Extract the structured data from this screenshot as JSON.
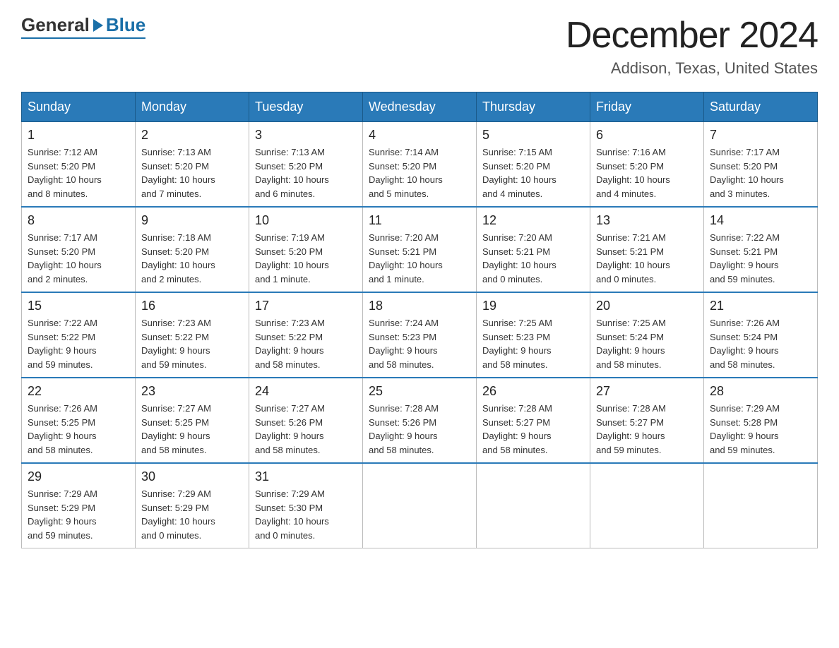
{
  "logo": {
    "general": "General",
    "blue": "Blue"
  },
  "title": "December 2024",
  "location": "Addison, Texas, United States",
  "days_of_week": [
    "Sunday",
    "Monday",
    "Tuesday",
    "Wednesday",
    "Thursday",
    "Friday",
    "Saturday"
  ],
  "weeks": [
    [
      {
        "day": "1",
        "sunrise": "7:12 AM",
        "sunset": "5:20 PM",
        "daylight": "10 hours and 8 minutes."
      },
      {
        "day": "2",
        "sunrise": "7:13 AM",
        "sunset": "5:20 PM",
        "daylight": "10 hours and 7 minutes."
      },
      {
        "day": "3",
        "sunrise": "7:13 AM",
        "sunset": "5:20 PM",
        "daylight": "10 hours and 6 minutes."
      },
      {
        "day": "4",
        "sunrise": "7:14 AM",
        "sunset": "5:20 PM",
        "daylight": "10 hours and 5 minutes."
      },
      {
        "day": "5",
        "sunrise": "7:15 AM",
        "sunset": "5:20 PM",
        "daylight": "10 hours and 4 minutes."
      },
      {
        "day": "6",
        "sunrise": "7:16 AM",
        "sunset": "5:20 PM",
        "daylight": "10 hours and 4 minutes."
      },
      {
        "day": "7",
        "sunrise": "7:17 AM",
        "sunset": "5:20 PM",
        "daylight": "10 hours and 3 minutes."
      }
    ],
    [
      {
        "day": "8",
        "sunrise": "7:17 AM",
        "sunset": "5:20 PM",
        "daylight": "10 hours and 2 minutes."
      },
      {
        "day": "9",
        "sunrise": "7:18 AM",
        "sunset": "5:20 PM",
        "daylight": "10 hours and 2 minutes."
      },
      {
        "day": "10",
        "sunrise": "7:19 AM",
        "sunset": "5:20 PM",
        "daylight": "10 hours and 1 minute."
      },
      {
        "day": "11",
        "sunrise": "7:20 AM",
        "sunset": "5:21 PM",
        "daylight": "10 hours and 1 minute."
      },
      {
        "day": "12",
        "sunrise": "7:20 AM",
        "sunset": "5:21 PM",
        "daylight": "10 hours and 0 minutes."
      },
      {
        "day": "13",
        "sunrise": "7:21 AM",
        "sunset": "5:21 PM",
        "daylight": "10 hours and 0 minutes."
      },
      {
        "day": "14",
        "sunrise": "7:22 AM",
        "sunset": "5:21 PM",
        "daylight": "9 hours and 59 minutes."
      }
    ],
    [
      {
        "day": "15",
        "sunrise": "7:22 AM",
        "sunset": "5:22 PM",
        "daylight": "9 hours and 59 minutes."
      },
      {
        "day": "16",
        "sunrise": "7:23 AM",
        "sunset": "5:22 PM",
        "daylight": "9 hours and 59 minutes."
      },
      {
        "day": "17",
        "sunrise": "7:23 AM",
        "sunset": "5:22 PM",
        "daylight": "9 hours and 58 minutes."
      },
      {
        "day": "18",
        "sunrise": "7:24 AM",
        "sunset": "5:23 PM",
        "daylight": "9 hours and 58 minutes."
      },
      {
        "day": "19",
        "sunrise": "7:25 AM",
        "sunset": "5:23 PM",
        "daylight": "9 hours and 58 minutes."
      },
      {
        "day": "20",
        "sunrise": "7:25 AM",
        "sunset": "5:24 PM",
        "daylight": "9 hours and 58 minutes."
      },
      {
        "day": "21",
        "sunrise": "7:26 AM",
        "sunset": "5:24 PM",
        "daylight": "9 hours and 58 minutes."
      }
    ],
    [
      {
        "day": "22",
        "sunrise": "7:26 AM",
        "sunset": "5:25 PM",
        "daylight": "9 hours and 58 minutes."
      },
      {
        "day": "23",
        "sunrise": "7:27 AM",
        "sunset": "5:25 PM",
        "daylight": "9 hours and 58 minutes."
      },
      {
        "day": "24",
        "sunrise": "7:27 AM",
        "sunset": "5:26 PM",
        "daylight": "9 hours and 58 minutes."
      },
      {
        "day": "25",
        "sunrise": "7:28 AM",
        "sunset": "5:26 PM",
        "daylight": "9 hours and 58 minutes."
      },
      {
        "day": "26",
        "sunrise": "7:28 AM",
        "sunset": "5:27 PM",
        "daylight": "9 hours and 58 minutes."
      },
      {
        "day": "27",
        "sunrise": "7:28 AM",
        "sunset": "5:27 PM",
        "daylight": "9 hours and 59 minutes."
      },
      {
        "day": "28",
        "sunrise": "7:29 AM",
        "sunset": "5:28 PM",
        "daylight": "9 hours and 59 minutes."
      }
    ],
    [
      {
        "day": "29",
        "sunrise": "7:29 AM",
        "sunset": "5:29 PM",
        "daylight": "9 hours and 59 minutes."
      },
      {
        "day": "30",
        "sunrise": "7:29 AM",
        "sunset": "5:29 PM",
        "daylight": "10 hours and 0 minutes."
      },
      {
        "day": "31",
        "sunrise": "7:29 AM",
        "sunset": "5:30 PM",
        "daylight": "10 hours and 0 minutes."
      },
      null,
      null,
      null,
      null
    ]
  ],
  "labels": {
    "sunrise": "Sunrise:",
    "sunset": "Sunset:",
    "daylight": "Daylight:"
  }
}
